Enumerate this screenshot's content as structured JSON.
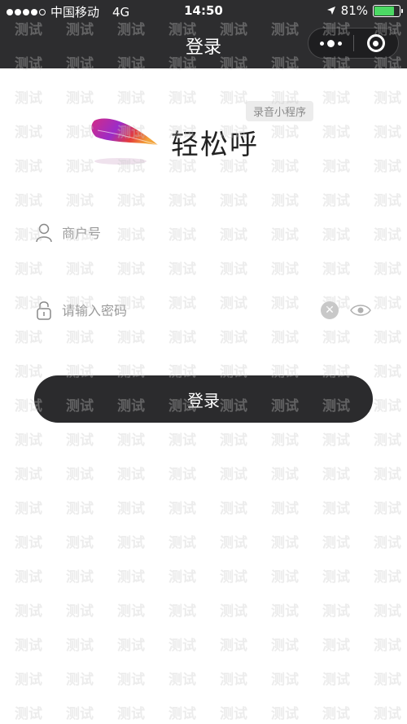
{
  "status_bar": {
    "carrier": "中国移动",
    "network": "4G",
    "time": "14:50",
    "battery_percent": "81%",
    "battery_level": 0.81,
    "location_icon": "location-arrow-icon",
    "battery_color": "#4cd964"
  },
  "nav": {
    "title": "登录",
    "more_icon": "more-dots-icon",
    "close_icon": "miniprogram-close-icon"
  },
  "tag": "录音小程序",
  "logo": {
    "text": "轻松呼",
    "feather_colors": [
      "#d22b86",
      "#9b2cc8",
      "#f2a33a",
      "#e53b3b"
    ]
  },
  "form": {
    "account_placeholder": "商户号",
    "password_placeholder": "请输入密码",
    "account_icon": "user-icon",
    "password_icon": "lock-icon",
    "clear_icon": "clear-icon",
    "eye_icon": "eye-icon"
  },
  "login_button": "登录",
  "watermark_text": "测试",
  "colors": {
    "header_bg": "#2d2d2f",
    "button_bg": "#2b2b2d"
  }
}
